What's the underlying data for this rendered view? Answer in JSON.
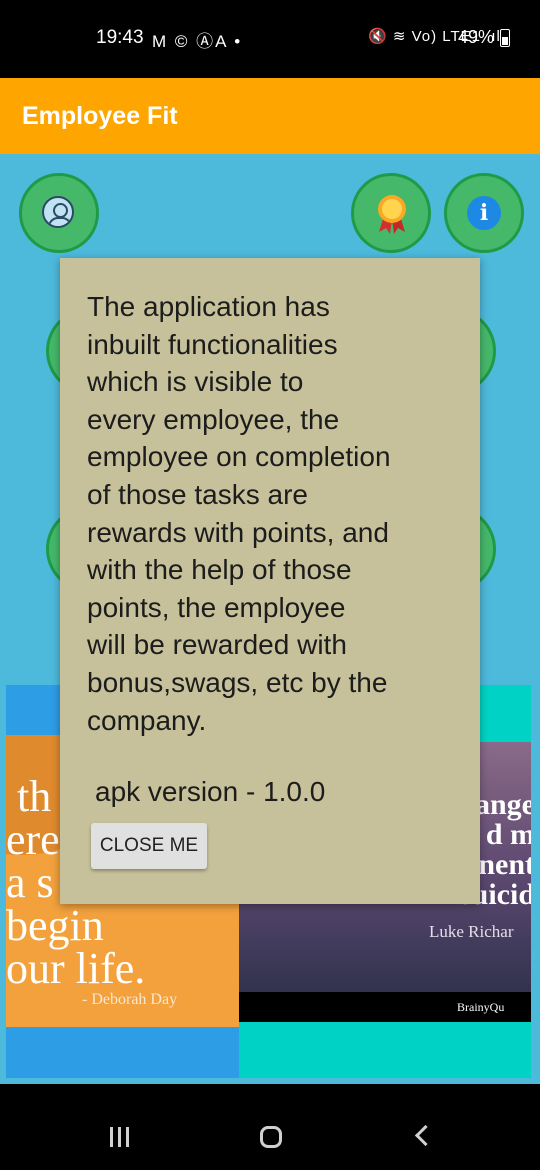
{
  "status_bar": {
    "time": "19:43",
    "left_icons": "M © ⒶA •",
    "right_icons": "🔇 ≋ Vo) LTE1 .ıl",
    "battery": "49%"
  },
  "app_bar": {
    "title": "Employee Fit",
    "color": "#FFA500"
  },
  "background_color": "#4DB9DB",
  "icons": {
    "profile": "profile-icon",
    "award": "medal-icon",
    "info": "info-icon",
    "info_glyph": "i"
  },
  "dialog": {
    "message": "The application has\ninbuilt functionalities\nwhich is visible to\nevery employee, the\nemployee on completion\nof those tasks are\nrewards with points, and\nwith the help of those\npoints, the employee\nwill be rewarded with\nbonus,swags, etc by the\ncompany.",
    "version": "apk version - 1.0.0",
    "close_label": "CLOSE ME"
  },
  "quotes": {
    "left": {
      "text": " th\nere\na s\nbegin\nour life.",
      "author": "- Deborah Day"
    },
    "right": {
      "text": "ange\nd m\nnent\nsuicid",
      "author": "Luke Richar",
      "brand": "BrainyQu"
    }
  },
  "nav_bar": {
    "recents": "recents-icon",
    "home": "home-icon",
    "back": "back-icon"
  }
}
